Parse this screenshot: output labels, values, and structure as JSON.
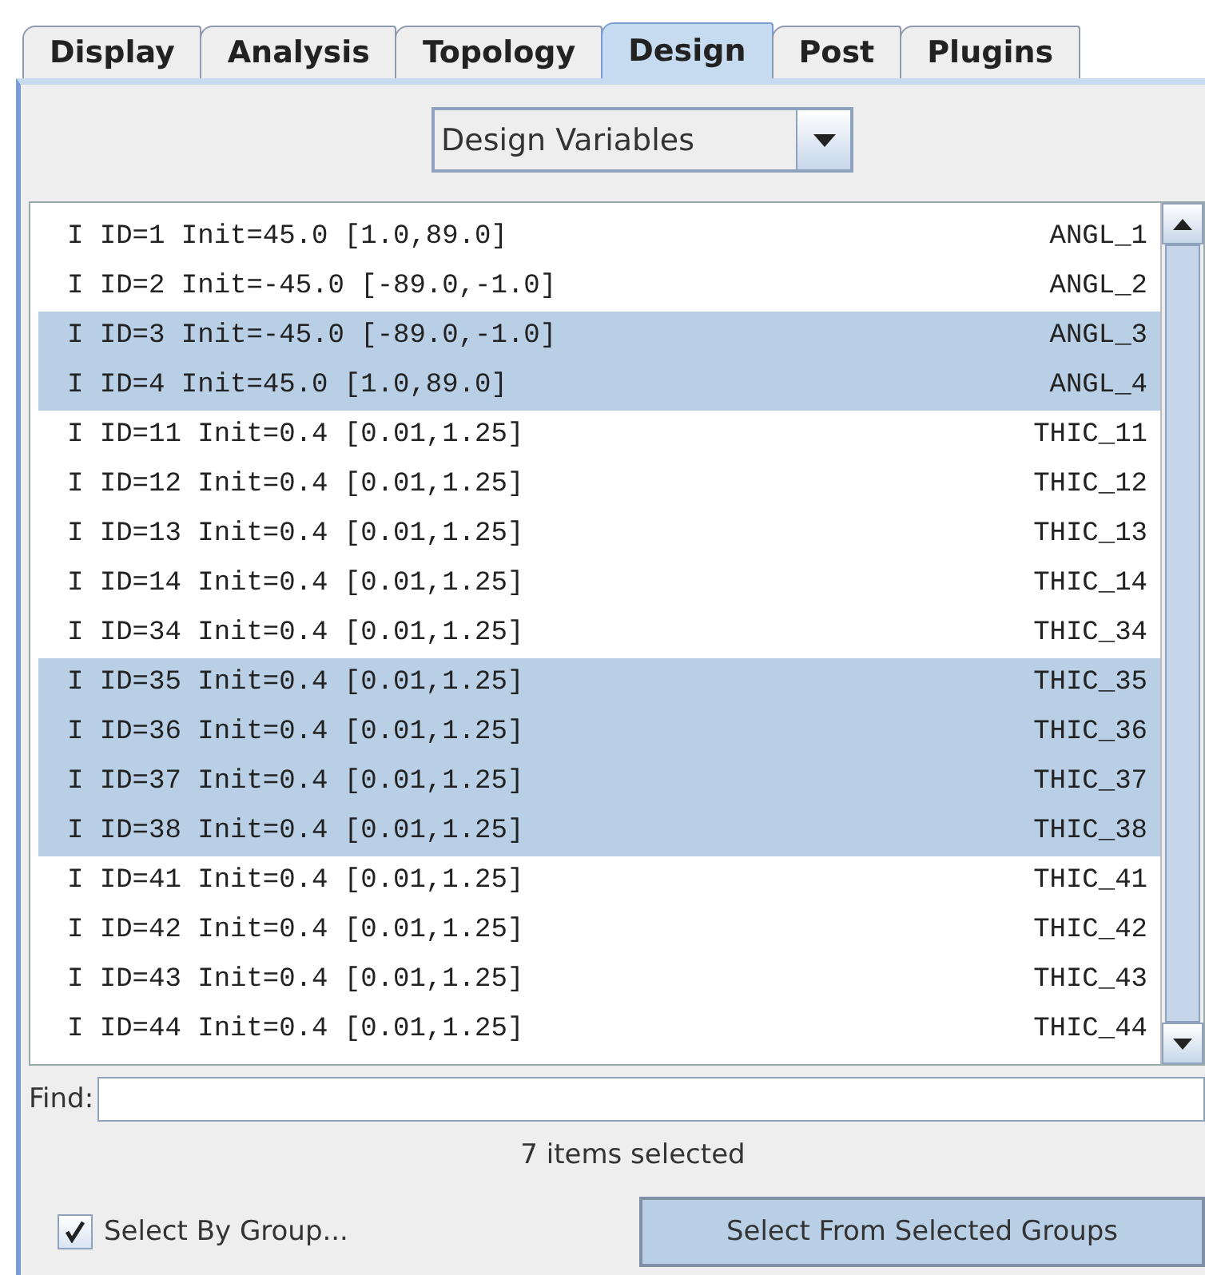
{
  "tabs": [
    {
      "label": "Display",
      "selected": false
    },
    {
      "label": "Analysis",
      "selected": false
    },
    {
      "label": "Topology",
      "selected": false
    },
    {
      "label": "Design",
      "selected": true
    },
    {
      "label": "Post",
      "selected": false
    },
    {
      "label": "Plugins",
      "selected": false
    }
  ],
  "dropdown": {
    "value": "Design Variables"
  },
  "list": {
    "rows": [
      {
        "text": "I ID=1 Init=45.0 [1.0,89.0]",
        "name": "ANGL_1",
        "selected": false
      },
      {
        "text": "I ID=2 Init=-45.0 [-89.0,-1.0]",
        "name": "ANGL_2",
        "selected": false
      },
      {
        "text": "I ID=3 Init=-45.0 [-89.0,-1.0]",
        "name": "ANGL_3",
        "selected": true
      },
      {
        "text": "I ID=4 Init=45.0 [1.0,89.0]",
        "name": "ANGL_4",
        "selected": true
      },
      {
        "text": "I ID=11 Init=0.4 [0.01,1.25]",
        "name": "THIC_11",
        "selected": false
      },
      {
        "text": "I ID=12 Init=0.4 [0.01,1.25]",
        "name": "THIC_12",
        "selected": false
      },
      {
        "text": "I ID=13 Init=0.4 [0.01,1.25]",
        "name": "THIC_13",
        "selected": false
      },
      {
        "text": "I ID=14 Init=0.4 [0.01,1.25]",
        "name": "THIC_14",
        "selected": false
      },
      {
        "text": "I ID=34 Init=0.4 [0.01,1.25]",
        "name": "THIC_34",
        "selected": false
      },
      {
        "text": "I ID=35 Init=0.4 [0.01,1.25]",
        "name": "THIC_35",
        "selected": true
      },
      {
        "text": "I ID=36 Init=0.4 [0.01,1.25]",
        "name": "THIC_36",
        "selected": true
      },
      {
        "text": "I ID=37 Init=0.4 [0.01,1.25]",
        "name": "THIC_37",
        "selected": true
      },
      {
        "text": "I ID=38 Init=0.4 [0.01,1.25]",
        "name": "THIC_38",
        "selected": true
      },
      {
        "text": "I ID=41 Init=0.4 [0.01,1.25]",
        "name": "THIC_41",
        "selected": false
      },
      {
        "text": "I ID=42 Init=0.4 [0.01,1.25]",
        "name": "THIC_42",
        "selected": false
      },
      {
        "text": "I ID=43 Init=0.4 [0.01,1.25]",
        "name": "THIC_43",
        "selected": false
      },
      {
        "text": "I ID=44 Init=0.4 [0.01,1.25]",
        "name": "THIC_44",
        "selected": false
      }
    ]
  },
  "find": {
    "label": "Find:"
  },
  "status": "7 items selected",
  "select_by_group": {
    "label": "Select By Group...",
    "checked": true
  },
  "select_button": {
    "label": "Select From Selected Groups"
  }
}
